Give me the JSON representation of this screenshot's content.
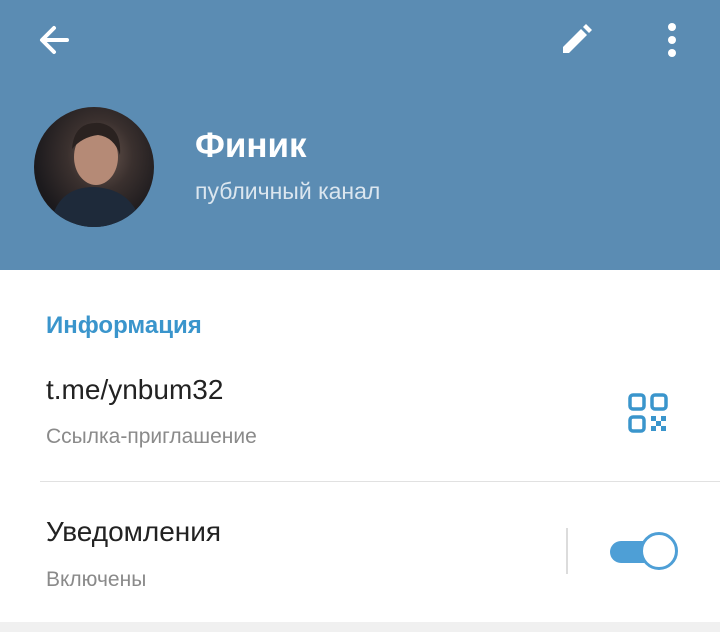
{
  "colors": {
    "header_bg": "#5b8cb3",
    "accent": "#3a95cc",
    "toggle_on": "#4e9fd6"
  },
  "toolbar": {
    "back_icon": "arrow-left-icon",
    "edit_icon": "pencil-icon",
    "more_icon": "more-vertical-icon"
  },
  "channel": {
    "name": "Финик",
    "subtitle": "публичный канал"
  },
  "info": {
    "section_title": "Информация",
    "link": {
      "value": "t.me/ynbum32",
      "caption": "Ссылка-приглашение",
      "icon": "qr-code-icon"
    },
    "notifications": {
      "label": "Уведомления",
      "status": "Включены",
      "enabled": true
    }
  }
}
